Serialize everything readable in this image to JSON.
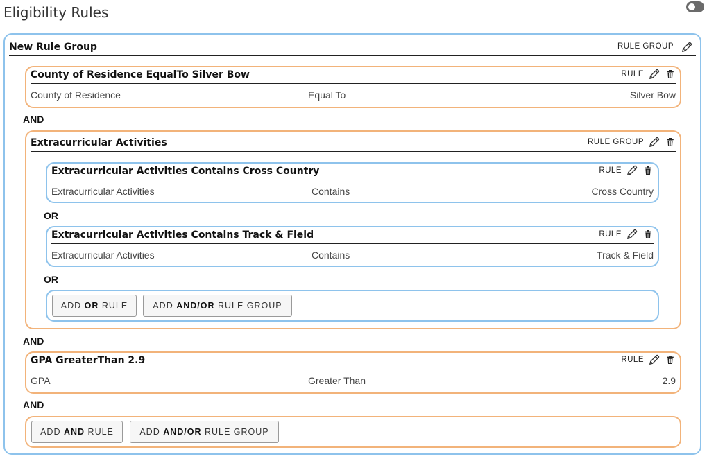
{
  "page": {
    "title": "Eligibility Rules"
  },
  "root_group": {
    "title": "New Rule Group",
    "tag": "RULE GROUP",
    "conj_1": "AND",
    "conj_2": "AND",
    "conj_3": "AND",
    "rule1": {
      "title": "County of Residence EqualTo Silver Bow",
      "tag": "RULE",
      "field": "County of Residence",
      "operator": "Equal To",
      "value": "Silver Bow"
    },
    "group": {
      "title": "Extracurricular Activities",
      "tag": "RULE GROUP",
      "conj_1": "OR",
      "conj_2": "OR",
      "rule1": {
        "title": "Extracurricular Activities Contains Cross Country",
        "tag": "RULE",
        "field": "Extracurricular Activities",
        "operator": "Contains",
        "value": "Cross Country"
      },
      "rule2": {
        "title": "Extracurricular Activities Contains Track & Field",
        "tag": "RULE",
        "field": "Extracurricular Activities",
        "operator": "Contains",
        "value": "Track & Field"
      },
      "buttons": {
        "add_rule": {
          "pre": "ADD ",
          "strong": "OR",
          "post": " RULE"
        },
        "add_group": {
          "pre": "ADD ",
          "strong": "AND/OR",
          "post": " RULE GROUP"
        }
      }
    },
    "rule3": {
      "title": "GPA GreaterThan 2.9",
      "tag": "RULE",
      "field": "GPA",
      "operator": "Greater Than",
      "value": "2.9"
    },
    "buttons": {
      "add_rule": {
        "pre": "ADD ",
        "strong": "AND",
        "post": " RULE"
      },
      "add_group": {
        "pre": "ADD ",
        "strong": "AND/OR",
        "post": " RULE GROUP"
      }
    }
  },
  "icons": {
    "edit": "pencil-icon",
    "delete": "trash-icon",
    "toggle": "toggle-switch"
  }
}
